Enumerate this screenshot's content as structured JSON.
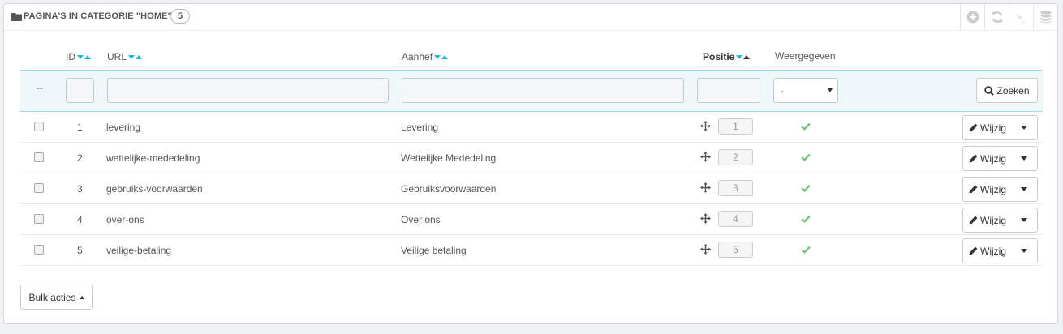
{
  "panel": {
    "title": "PAGINA'S IN CATEGORIE \"HOME\"",
    "count": "5",
    "toolbar": [
      "add-icon",
      "refresh-icon",
      "sql-terminal-icon",
      "database-icon"
    ],
    "terminal_glyph": ">_"
  },
  "columns": {
    "id": "ID",
    "url": "URL",
    "aanhef": "Aanhef",
    "positie": "Positie",
    "weergegeven": "Weergegeven"
  },
  "filters": {
    "dash": "--",
    "displayed_value": "-",
    "search_label": "Zoeken"
  },
  "rows": [
    {
      "id": "1",
      "url": "levering",
      "aanhef": "Levering",
      "position": "1",
      "displayed": true
    },
    {
      "id": "2",
      "url": "wettelijke-mededeling",
      "aanhef": "Wettelijke Mededeling",
      "position": "2",
      "displayed": true
    },
    {
      "id": "3",
      "url": "gebruiks-voorwaarden",
      "aanhef": "Gebruiksvoorwaarden",
      "position": "3",
      "displayed": true
    },
    {
      "id": "4",
      "url": "over-ons",
      "aanhef": "Over ons",
      "position": "4",
      "displayed": true
    },
    {
      "id": "5",
      "url": "veilige-betaling",
      "aanhef": "Veilige betaling",
      "position": "5",
      "displayed": true
    }
  ],
  "row_actions": {
    "edit_label": "Wijzig"
  },
  "footer": {
    "bulk_label": "Bulk acties"
  },
  "colors": {
    "accent": "#25b9d7",
    "check": "#72c279",
    "filter_bg": "#eef8fb"
  }
}
